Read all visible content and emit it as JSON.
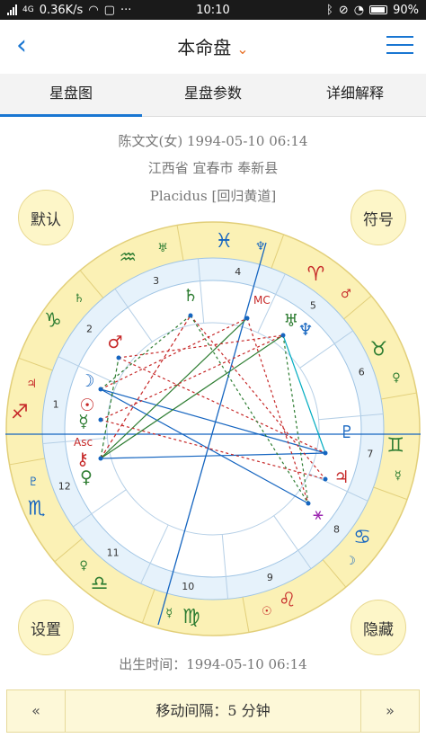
{
  "status": {
    "signal": "4G",
    "speed": "0.36K/s",
    "time": "10:10",
    "battery": "90%"
  },
  "nav": {
    "title": "本命盘",
    "dropdown_glyph": "⌄"
  },
  "tabs": [
    {
      "label": "星盘图",
      "active": true
    },
    {
      "label": "星盘参数",
      "active": false
    },
    {
      "label": "详细解释",
      "active": false
    }
  ],
  "profile": {
    "line1": "陈文文(女) 1994-05-10 06:14",
    "line2": "江西省 宜春市 奉新县",
    "line3": "Placidus [回归黄道]"
  },
  "buttons": {
    "default": "默认",
    "symbols": "符号",
    "settings": "设置",
    "hide": "隐藏"
  },
  "birth_time": "出生时间：1994-05-10 06:14",
  "stepper": {
    "prev": "«",
    "label": "移动间隔：5 分钟",
    "next": "»"
  },
  "chart_glyphs": {
    "signs": [
      {
        "glyph": "♓",
        "color": "#1565c0"
      },
      {
        "glyph": "♒",
        "color": "#2e7d32"
      },
      {
        "glyph": "♑",
        "color": "#2e7d32"
      },
      {
        "glyph": "♐",
        "color": "#c62828"
      },
      {
        "glyph": "♏",
        "color": "#1565c0"
      },
      {
        "glyph": "♎",
        "color": "#2e7d32"
      },
      {
        "glyph": "♍",
        "color": "#2e7d32"
      },
      {
        "glyph": "♌",
        "color": "#c62828"
      },
      {
        "glyph": "♋",
        "color": "#1565c0"
      },
      {
        "glyph": "♊",
        "color": "#2e7d32"
      },
      {
        "glyph": "♉",
        "color": "#2e7d32"
      },
      {
        "glyph": "♈",
        "color": "#c62828"
      }
    ],
    "rulers": [
      {
        "glyph": "♆",
        "color": "#1565c0"
      },
      {
        "glyph": "♅",
        "color": "#2e7d32"
      },
      {
        "glyph": "♄",
        "color": "#2e7d32"
      },
      {
        "glyph": "♃",
        "color": "#c62828"
      },
      {
        "glyph": "♇",
        "color": "#1565c0"
      },
      {
        "glyph": "♀",
        "color": "#2e7d32"
      },
      {
        "glyph": "☿",
        "color": "#2e7d32"
      },
      {
        "glyph": "☉",
        "color": "#c62828"
      },
      {
        "glyph": "☽",
        "color": "#1565c0"
      },
      {
        "glyph": "☿",
        "color": "#2e7d32"
      },
      {
        "glyph": "♀",
        "color": "#2e7d32"
      },
      {
        "glyph": "♂",
        "color": "#c62828"
      }
    ],
    "houses": [
      "1",
      "2",
      "3",
      "4",
      "5",
      "6",
      "7",
      "8",
      "9",
      "10",
      "11",
      "12"
    ],
    "mc_label": "MC",
    "asc_label": "Asc",
    "planets": [
      {
        "glyph": "☽",
        "color": "#1565c0"
      },
      {
        "glyph": "☉",
        "color": "#c62828"
      },
      {
        "glyph": "☿",
        "color": "#2e7d32"
      },
      {
        "glyph": "♀",
        "color": "#2e7d32"
      },
      {
        "glyph": "♂",
        "color": "#c62828"
      },
      {
        "glyph": "♄",
        "color": "#2e7d32"
      },
      {
        "glyph": "♅",
        "color": "#2e7d32"
      },
      {
        "glyph": "♆",
        "color": "#1565c0"
      },
      {
        "glyph": "♇",
        "color": "#1565c0"
      },
      {
        "glyph": "♃",
        "color": "#c62828"
      },
      {
        "glyph": "⚹",
        "color": "#9c27b0"
      },
      {
        "glyph": "⚷",
        "color": "#c62828"
      }
    ]
  }
}
